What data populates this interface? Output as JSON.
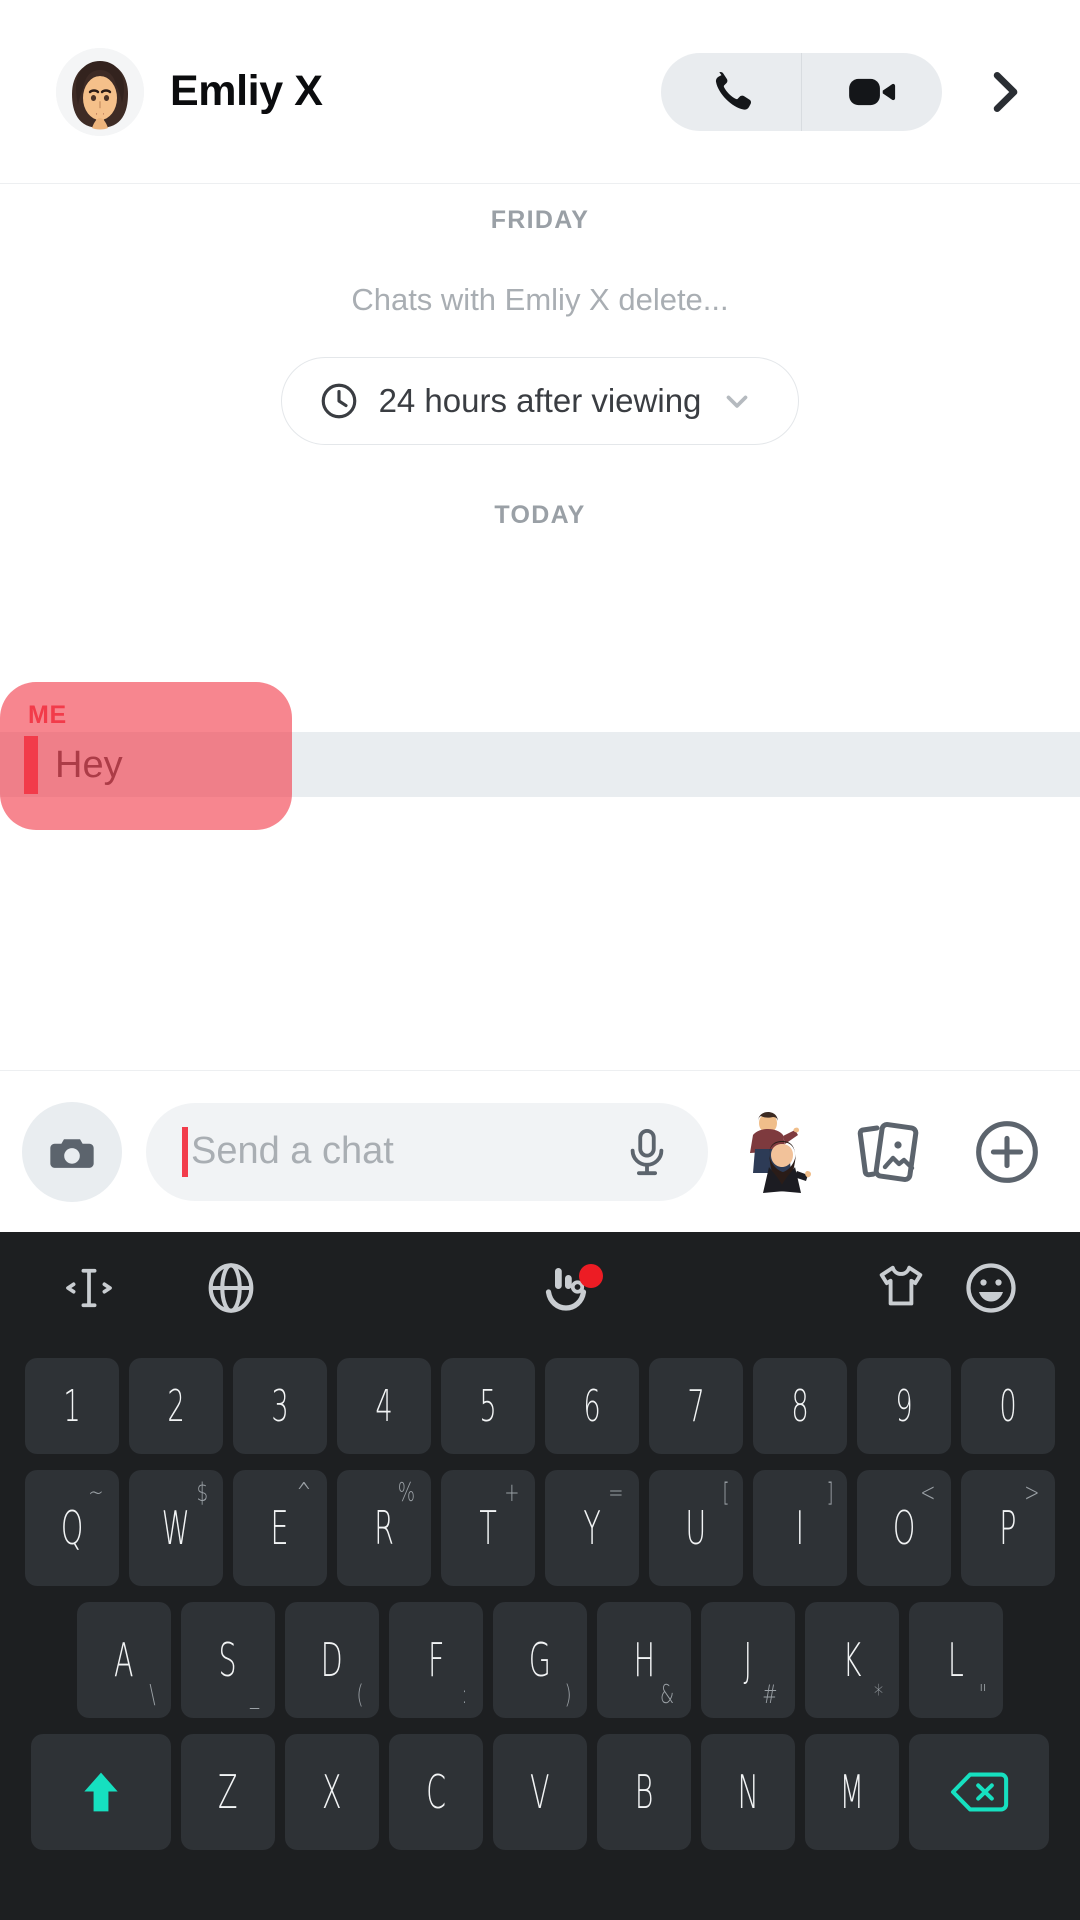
{
  "header": {
    "contact_name": "Emliy X",
    "avatar_name": "contact-bitmoji-avatar",
    "call_icon": "phone-icon",
    "video_icon": "video-camera-icon",
    "forward_icon": "chevron-right-icon"
  },
  "conversation": {
    "day_friday": "FRIDAY",
    "delete_note": "Chats with Emliy X delete...",
    "timer": {
      "clock_icon": "clock-icon",
      "label": "24 hours after viewing",
      "chevron_icon": "chevron-down-icon"
    },
    "day_today": "TODAY",
    "message": {
      "sender": "ME",
      "text": "Hey"
    }
  },
  "input_bar": {
    "camera_icon": "camera-icon",
    "placeholder": "Send a chat",
    "value": "",
    "mic_icon": "microphone-icon",
    "bitmoji_icon": "bitmoji-sticker-icon",
    "cards_icon": "memories-cards-icon",
    "plus_icon": "plus-circle-icon"
  },
  "keyboard": {
    "toolbar": [
      {
        "name": "cursor-move-icon",
        "badge": false
      },
      {
        "name": "globe-language-icon",
        "badge": false
      },
      {
        "name": "keyboard-logo-icon",
        "badge": true
      },
      {
        "name": "theme-shirt-icon",
        "badge": false
      },
      {
        "name": "emoji-face-icon",
        "badge": false
      }
    ],
    "rows": [
      {
        "name": "number-row",
        "keys": [
          {
            "main": "1",
            "sub": ""
          },
          {
            "main": "2",
            "sub": ""
          },
          {
            "main": "3",
            "sub": ""
          },
          {
            "main": "4",
            "sub": ""
          },
          {
            "main": "5",
            "sub": ""
          },
          {
            "main": "6",
            "sub": ""
          },
          {
            "main": "7",
            "sub": ""
          },
          {
            "main": "8",
            "sub": ""
          },
          {
            "main": "9",
            "sub": ""
          },
          {
            "main": "0",
            "sub": ""
          }
        ]
      },
      {
        "name": "qwerty-row",
        "keys": [
          {
            "main": "Q",
            "sub": "~"
          },
          {
            "main": "W",
            "sub": "$"
          },
          {
            "main": "E",
            "sub": "^"
          },
          {
            "main": "R",
            "sub": "%"
          },
          {
            "main": "T",
            "sub": "+"
          },
          {
            "main": "Y",
            "sub": "="
          },
          {
            "main": "U",
            "sub": "["
          },
          {
            "main": "I",
            "sub": "]"
          },
          {
            "main": "O",
            "sub": "<"
          },
          {
            "main": "P",
            "sub": ">"
          }
        ]
      },
      {
        "name": "home-row",
        "keys": [
          {
            "main": "A",
            "sub": "\\"
          },
          {
            "main": "S",
            "sub": "_"
          },
          {
            "main": "D",
            "sub": "("
          },
          {
            "main": "F",
            "sub": ":"
          },
          {
            "main": "G",
            "sub": ")"
          },
          {
            "main": "H",
            "sub": "&"
          },
          {
            "main": "J",
            "sub": "#"
          },
          {
            "main": "K",
            "sub": "*"
          },
          {
            "main": "L",
            "sub": "\""
          }
        ]
      },
      {
        "name": "bottom-row",
        "keys": [
          {
            "main": "Z",
            "sub": ""
          },
          {
            "main": "X",
            "sub": ""
          },
          {
            "main": "C",
            "sub": ""
          },
          {
            "main": "V",
            "sub": ""
          },
          {
            "main": "B",
            "sub": ""
          },
          {
            "main": "N",
            "sub": ""
          },
          {
            "main": "M",
            "sub": ""
          }
        ],
        "shift_icon": "shift-arrow-icon",
        "backspace_icon": "backspace-icon"
      }
    ]
  },
  "colors": {
    "accent_red": "#F23C4B",
    "keyboard_bg": "#1D1F21",
    "key_bg": "#2E3236",
    "teal": "#16E0C0",
    "badge_red": "#ED1C24",
    "pill_gray": "#E9ECEF"
  }
}
